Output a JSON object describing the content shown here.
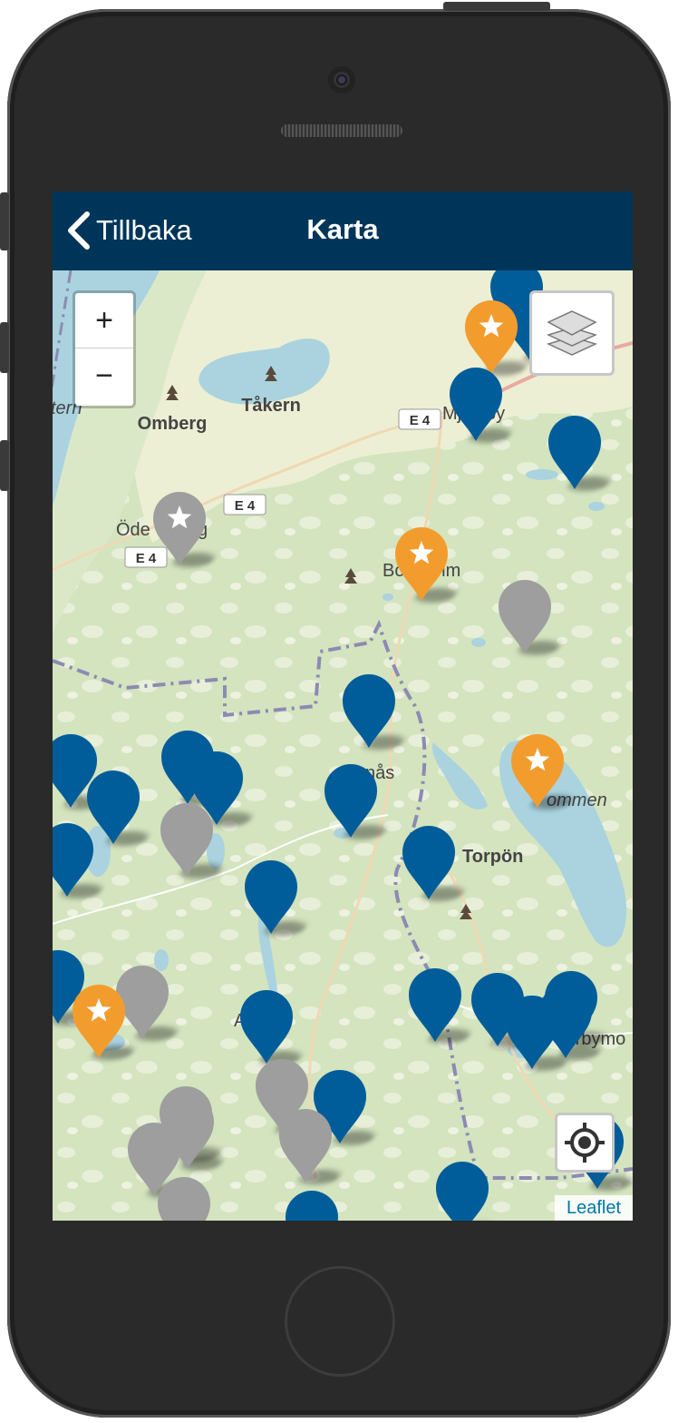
{
  "navbar": {
    "back_label": "Tillbaka",
    "title": "Karta",
    "background": "#00355a"
  },
  "zoom": {
    "in_label": "+",
    "out_label": "−"
  },
  "attribution": "Leaflet",
  "map": {
    "places": [
      "Omberg",
      "Tåkern",
      "Mjölby",
      "Ödeshög",
      "Boxholm",
      "Tranås",
      "Torpön",
      "Sommen",
      "Aneby",
      "Österbymo",
      "Vättern"
    ],
    "visible_label_fragments": [
      "Öde",
      "g",
      "Mj",
      "by",
      "Box",
      "olm",
      "nås",
      "ommen",
      "A",
      "y",
      "terbymo",
      "tern"
    ],
    "roads": [
      "E 4",
      "E 4",
      "E 4"
    ]
  },
  "marker_colors": {
    "blue": "#005d99",
    "orange": "#f39c2e",
    "gray": "#9e9e9e"
  },
  "icons": [
    "chevron-left-icon",
    "layers-icon",
    "locate-icon",
    "star-icon",
    "tree-icon"
  ]
}
